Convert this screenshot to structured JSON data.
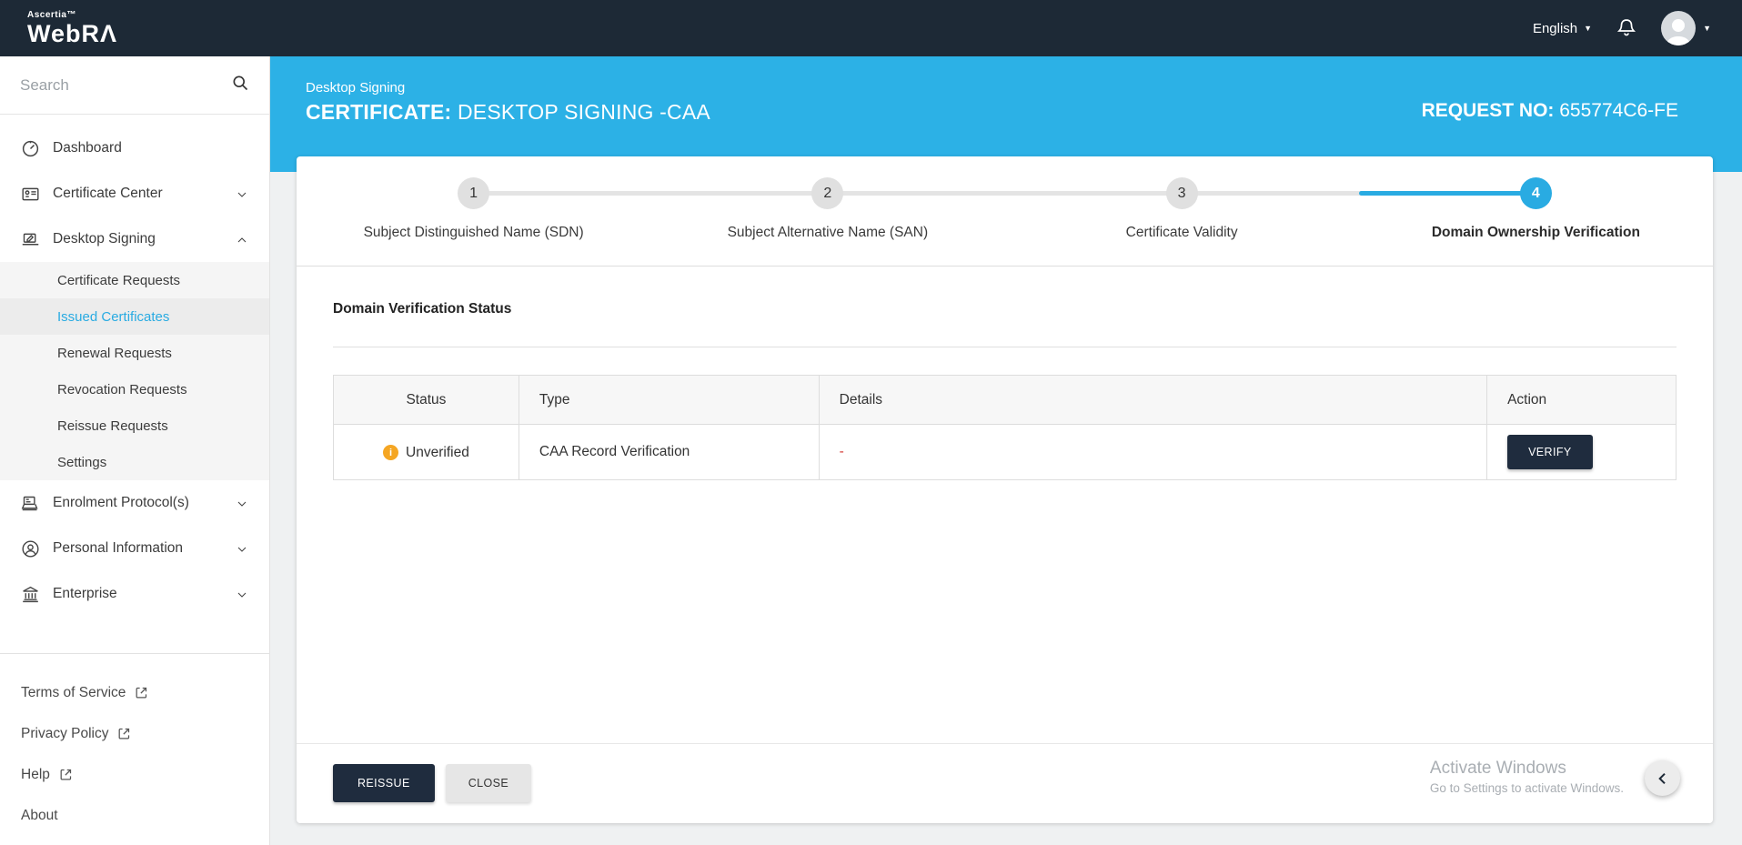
{
  "topbar": {
    "brand_small": "Ascertia™",
    "brand": "WebRΛ",
    "language": "English"
  },
  "sidebar": {
    "search_placeholder": "Search",
    "items": [
      {
        "label": "Dashboard"
      },
      {
        "label": "Certificate Center"
      },
      {
        "label": "Desktop Signing"
      },
      {
        "label": "Enrolment Protocol(s)"
      },
      {
        "label": "Personal Information"
      },
      {
        "label": "Enterprise"
      }
    ],
    "submenu": [
      {
        "label": "Certificate Requests"
      },
      {
        "label": "Issued Certificates"
      },
      {
        "label": "Renewal Requests"
      },
      {
        "label": "Revocation Requests"
      },
      {
        "label": "Reissue Requests"
      },
      {
        "label": "Settings"
      }
    ],
    "footer": [
      {
        "label": "Terms of Service"
      },
      {
        "label": "Privacy Policy"
      },
      {
        "label": "Help"
      },
      {
        "label": "About"
      }
    ]
  },
  "banner": {
    "breadcrumb": "Desktop Signing",
    "title_prefix": "CERTIFICATE:",
    "title_rest": " DESKTOP SIGNING -CAA",
    "request_label": "REQUEST NO:",
    "request_value": " 655774C6-FE"
  },
  "stepper": {
    "steps": [
      {
        "num": "1",
        "label": "Subject Distinguished Name (SDN)"
      },
      {
        "num": "2",
        "label": "Subject Alternative Name (SAN)"
      },
      {
        "num": "3",
        "label": "Certificate Validity"
      },
      {
        "num": "4",
        "label": "Domain Ownership Verification"
      }
    ]
  },
  "section": {
    "heading": "Domain Verification Status"
  },
  "table": {
    "headers": {
      "status": "Status",
      "type": "Type",
      "details": "Details",
      "action": "Action"
    },
    "row": {
      "status": "Unverified",
      "status_icon": "i",
      "type": "CAA Record Verification",
      "details": "-",
      "action": "VERIFY"
    }
  },
  "footer_buttons": {
    "reissue": "REISSUE",
    "close": "CLOSE"
  },
  "watermark": {
    "line1": "Activate Windows",
    "line2": "Go to Settings to activate Windows."
  },
  "colors": {
    "accent_blue": "#29abe2",
    "navy": "#1f2c3e",
    "warning_orange": "#f5a623",
    "error_red": "#d43f3a"
  }
}
